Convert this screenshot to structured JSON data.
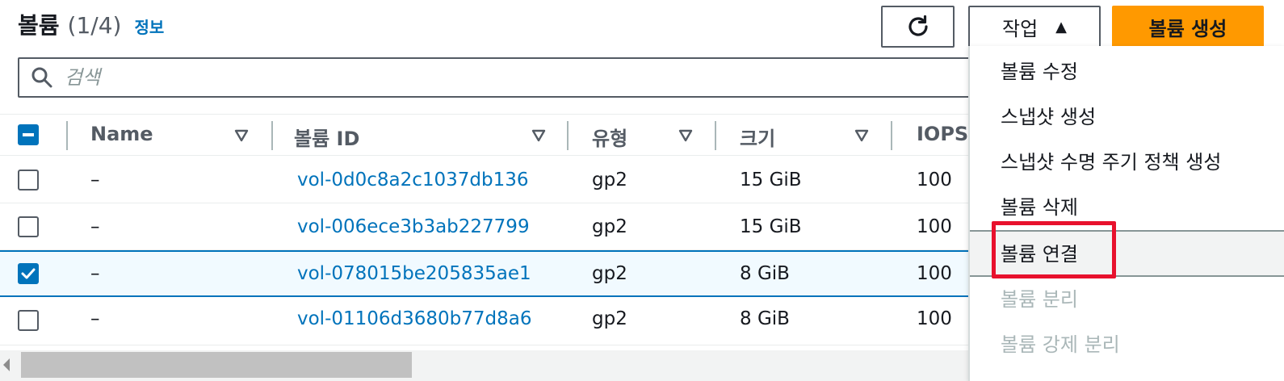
{
  "header": {
    "title": "볼륨",
    "count": "(1/4)",
    "info": "정보"
  },
  "buttons": {
    "actions": "작업",
    "create": "볼륨 생성"
  },
  "search": {
    "placeholder": "검색"
  },
  "columns": [
    "Name",
    "볼륨 ID",
    "유형",
    "크기",
    "IOPS"
  ],
  "rows": [
    {
      "name": "–",
      "volume_id": "vol-0d0c8a2c1037db136",
      "type": "gp2",
      "size": "15 GiB",
      "iops": "100",
      "selected": false
    },
    {
      "name": "–",
      "volume_id": "vol-006ece3b3ab227799",
      "type": "gp2",
      "size": "15 GiB",
      "iops": "100",
      "selected": false
    },
    {
      "name": "–",
      "volume_id": "vol-078015be205835ae1",
      "type": "gp2",
      "size": "8 GiB",
      "iops": "100",
      "selected": true
    },
    {
      "name": "–",
      "volume_id": "vol-01106d3680b77d8a6",
      "type": "gp2",
      "size": "8 GiB",
      "iops": "100",
      "selected": false
    }
  ],
  "menu": {
    "items": [
      {
        "label": "볼륨 수정",
        "disabled": false
      },
      {
        "label": "스냅샷 생성",
        "disabled": false
      },
      {
        "label": "스냅샷 수명 주기 정책 생성",
        "disabled": false
      },
      {
        "label": "볼륨 삭제",
        "disabled": false
      },
      {
        "label": "볼륨 연결",
        "disabled": false,
        "highlighted": true
      },
      {
        "label": "볼륨 분리",
        "disabled": true
      },
      {
        "label": "볼륨 강제 분리",
        "disabled": true
      }
    ]
  },
  "colors": {
    "primary": "#ff9900",
    "link": "#0073bb",
    "highlight": "#e8112d"
  }
}
